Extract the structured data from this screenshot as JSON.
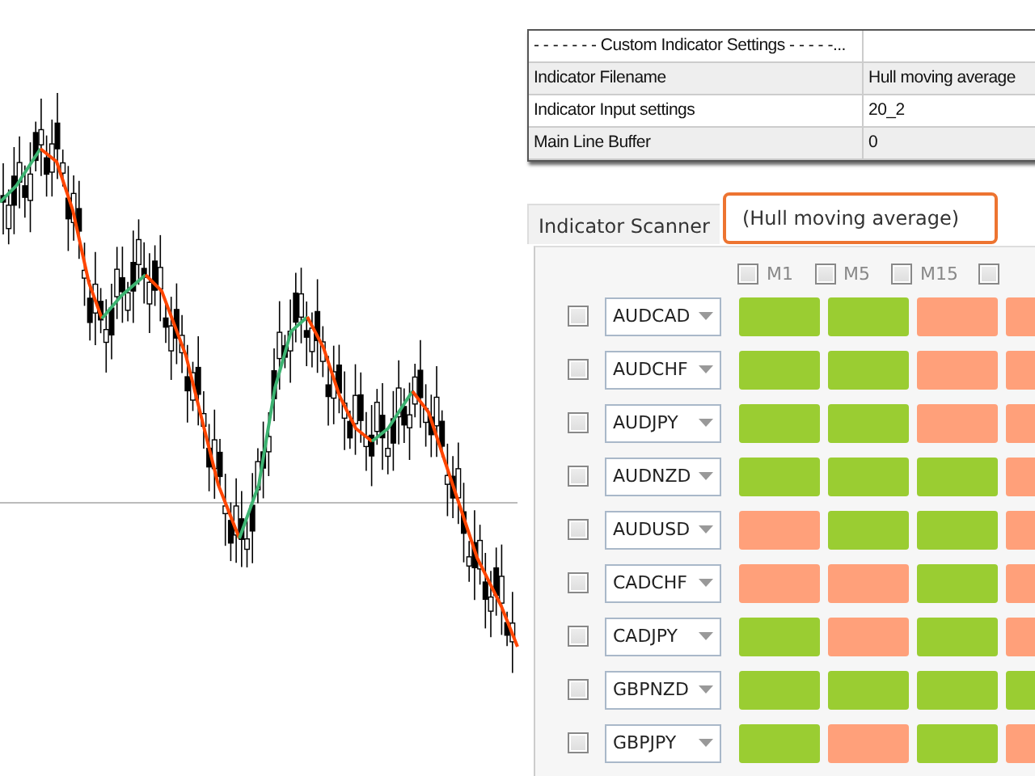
{
  "settings_table": {
    "header": "- - - - - - - Custom Indicator Settings - - - - -...",
    "rows": [
      {
        "label": "Indicator Filename",
        "value": "Hull moving average"
      },
      {
        "label": "Indicator Input settings",
        "value": "20_2"
      },
      {
        "label": "Main Line Buffer",
        "value": "0"
      }
    ]
  },
  "scanner": {
    "tab": "Indicator Scanner",
    "indicator": "(Hull moving average)",
    "timeframes": [
      {
        "label": "M1",
        "checked": false
      },
      {
        "label": "M5",
        "checked": false
      },
      {
        "label": "M15",
        "checked": false
      },
      {
        "checked": false
      }
    ],
    "rows": [
      {
        "symbol": "AUDCAD",
        "checked": false,
        "signals": [
          {
            "color": "#9acd32"
          },
          {
            "color": "#9acd32"
          },
          {
            "color": "#ffa07a"
          },
          {
            "color": "#ffa07a"
          }
        ]
      },
      {
        "symbol": "AUDCHF",
        "checked": false,
        "signals": [
          {
            "color": "#9acd32"
          },
          {
            "color": "#9acd32"
          },
          {
            "color": "#ffa07a"
          },
          {
            "color": "#ffa07a"
          }
        ]
      },
      {
        "symbol": "AUDJPY",
        "checked": false,
        "signals": [
          {
            "color": "#9acd32"
          },
          {
            "color": "#9acd32"
          },
          {
            "color": "#ffa07a"
          },
          {
            "color": "#ffa07a"
          }
        ]
      },
      {
        "symbol": "AUDNZD",
        "checked": false,
        "signals": [
          {
            "color": "#9acd32"
          },
          {
            "color": "#9acd32"
          },
          {
            "color": "#9acd32"
          },
          {
            "color": "#ffa07a"
          }
        ]
      },
      {
        "symbol": "AUDUSD",
        "checked": false,
        "signals": [
          {
            "color": "#ffa07a"
          },
          {
            "color": "#9acd32"
          },
          {
            "color": "#9acd32"
          },
          {
            "color": "#ffa07a"
          }
        ]
      },
      {
        "symbol": "CADCHF",
        "checked": false,
        "signals": [
          {
            "color": "#ffa07a"
          },
          {
            "color": "#ffa07a"
          },
          {
            "color": "#9acd32"
          },
          {
            "color": "#ffa07a"
          }
        ]
      },
      {
        "symbol": "CADJPY",
        "checked": false,
        "signals": [
          {
            "color": "#9acd32"
          },
          {
            "color": "#ffa07a"
          },
          {
            "color": "#9acd32"
          },
          {
            "color": "#ffa07a"
          }
        ]
      },
      {
        "symbol": "GBPNZD",
        "checked": false,
        "signals": [
          {
            "color": "#9acd32"
          },
          {
            "color": "#9acd32"
          },
          {
            "color": "#9acd32"
          },
          {
            "color": "#9acd32"
          }
        ]
      },
      {
        "symbol": "GBPJPY",
        "checked": false,
        "signals": [
          {
            "color": "#9acd32"
          },
          {
            "color": "#ffa07a"
          },
          {
            "color": "#9acd32"
          },
          {
            "color": "#ffa07a"
          }
        ]
      }
    ]
  }
}
